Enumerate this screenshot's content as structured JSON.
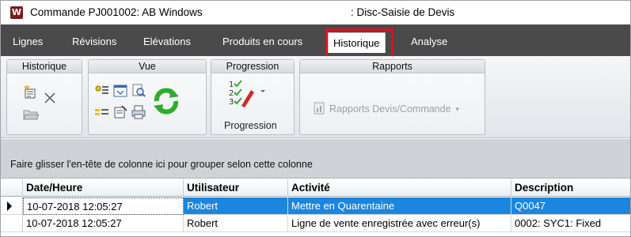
{
  "window": {
    "title": "Commande PJ001002: AB Windows",
    "subtitle": ": Disc-Saisie de Devis",
    "app_icon": "W"
  },
  "menubar": {
    "items": [
      {
        "label": "Lignes"
      },
      {
        "label": "Révisions"
      },
      {
        "label": "Elévations"
      },
      {
        "label": "Produits en cours"
      },
      {
        "label": "Historique",
        "active": true
      },
      {
        "label": "Analyse"
      }
    ],
    "highlight_color": "#e0101a"
  },
  "ribbon": {
    "groups": [
      {
        "header": "Historique",
        "icons": [
          "new-entry-icon",
          "delete-icon",
          "open-folder-icon"
        ]
      },
      {
        "header": "Vue",
        "icons": [
          "show-columns-icon",
          "filter-panel-icon",
          "preview-icon",
          "refresh-icon",
          "details-icon",
          "properties-icon",
          "print-icon"
        ]
      },
      {
        "header": "Progression",
        "button_label": "Progression",
        "icon": "checklist-icon"
      },
      {
        "header": "Rapports",
        "button_label": "Rapports Devis/Commande",
        "icon": "report-icon",
        "disabled": true
      }
    ]
  },
  "grid": {
    "group_panel_text": "Faire glisser l'en-tête de colonne ici pour grouper selon cette colonne",
    "columns": [
      "Date/Heure",
      "Utilisateur",
      "Activité",
      "Description"
    ],
    "rows": [
      {
        "date": "10-07-2018 12:05:27",
        "user": "Robert",
        "activity": "Mettre en Quarentaine",
        "description": "Q0047",
        "selected": true
      },
      {
        "date": "10-07-2018 12:05:27",
        "user": "Robert",
        "activity": "Ligne de vente enregistrée avec erreur(s)",
        "description": "0002: SYC1: Fixed",
        "selected": false
      }
    ],
    "selection_color": "#1a86e0"
  }
}
